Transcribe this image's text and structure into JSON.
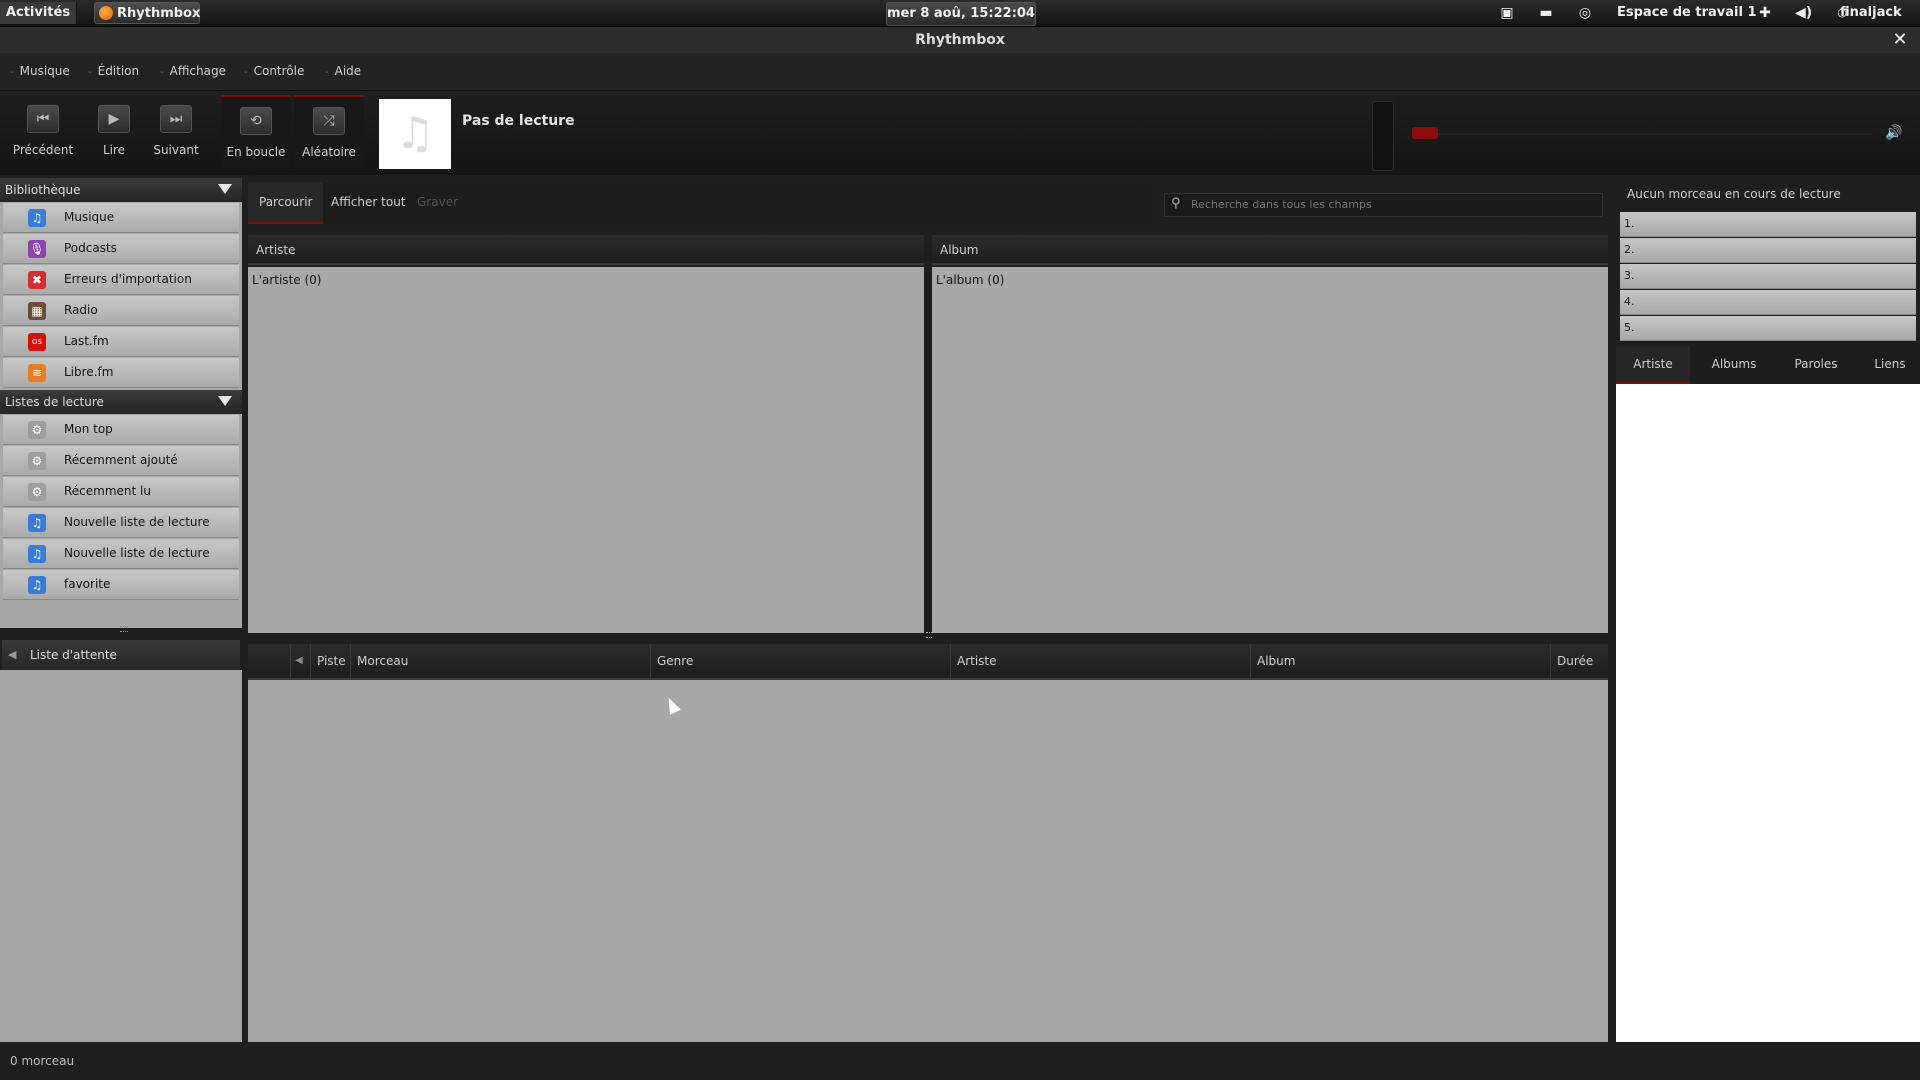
{
  "topbar": {
    "activities": "Activités",
    "app_name": "Rhythmbox",
    "clock": "mer  8 aoû, 15:22:04",
    "workspace": "Espace de travail 1",
    "user": "finaljack"
  },
  "window": {
    "title": "Rhythmbox"
  },
  "menu": [
    "Musique",
    "Édition",
    "Affichage",
    "Contrôle",
    "Aide"
  ],
  "toolbar": {
    "prev": "Précédent",
    "play": "Lire",
    "next": "Suivant",
    "repeat": "En boucle",
    "shuffle": "Aléatoire",
    "now_playing": "Pas de lecture"
  },
  "sidebar": {
    "library_title": "Bibliothèque",
    "library": [
      {
        "label": "Musique",
        "icon": "music-note-icon",
        "color": "#3a7bd5"
      },
      {
        "label": "Podcasts",
        "icon": "podcast-icon",
        "color": "#8e44ad"
      },
      {
        "label": "Erreurs d'importation",
        "icon": "error-icon",
        "color": "#d32f2f"
      },
      {
        "label": "Radio",
        "icon": "radio-icon",
        "color": "#6b4f3a"
      },
      {
        "label": "Last.fm",
        "icon": "lastfm-icon",
        "color": "#d51007"
      },
      {
        "label": "Libre.fm",
        "icon": "librefm-icon",
        "color": "#e67e22"
      }
    ],
    "playlists_title": "Listes de lecture",
    "playlists": [
      {
        "label": "Mon top",
        "icon": "gear-icon",
        "color": "#9e9e9e"
      },
      {
        "label": "Récemment ajouté",
        "icon": "gear-icon",
        "color": "#9e9e9e"
      },
      {
        "label": "Récemment lu",
        "icon": "gear-icon",
        "color": "#9e9e9e"
      },
      {
        "label": "Nouvelle liste de lecture",
        "icon": "music-note-icon",
        "color": "#3a7bd5"
      },
      {
        "label": "Nouvelle liste de lecture",
        "icon": "music-note-icon",
        "color": "#3a7bd5"
      },
      {
        "label": "favorite",
        "icon": "music-note-icon",
        "color": "#3a7bd5"
      }
    ],
    "queue_title": "Liste d'attente"
  },
  "browser": {
    "tabs": [
      "Parcourir",
      "Afficher tout",
      "Graver"
    ],
    "search_placeholder": "Recherche dans tous les champs",
    "artist_header": "Artiste",
    "artist_row": "L'artiste (0)",
    "album_header": "Album",
    "album_row": "L'album (0)"
  },
  "tracks": {
    "columns": [
      "Piste",
      "Morceau",
      "Genre",
      "Artiste",
      "Album",
      "Durée"
    ]
  },
  "context": {
    "now_playing": "Aucun morceau en cours de lecture",
    "top5": [
      "1.",
      "2.",
      "3.",
      "4.",
      "5."
    ],
    "tabs": [
      "Artiste",
      "Albums",
      "Paroles",
      "Liens"
    ]
  },
  "status": "0 morceau",
  "colors": {
    "accent": "#7a0d0d",
    "pane_bg": "#a8a8a8"
  }
}
